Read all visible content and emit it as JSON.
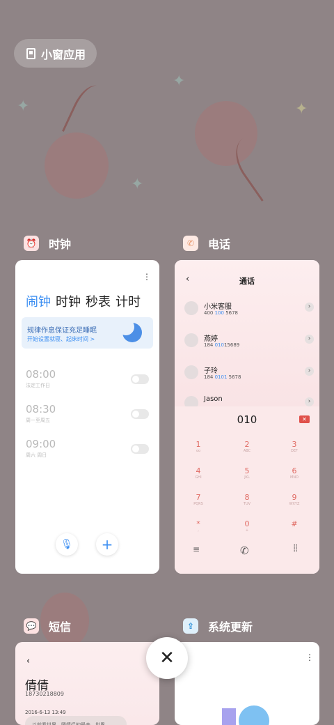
{
  "pill": {
    "label": "小窗应用"
  },
  "cards": {
    "clock": {
      "app_name": "时钟",
      "tabs": [
        "闹钟",
        "时钟",
        "秒表",
        "计时"
      ],
      "banner_title": "规律作息保证充足睡眠",
      "banner_sub": "开始设置就寝、起床时间 >",
      "alarms": [
        {
          "time": "08:00",
          "repeat": "法定工作日"
        },
        {
          "time": "08:30",
          "repeat": "周一至周五"
        },
        {
          "time": "09:00",
          "repeat": "周六 周日"
        }
      ]
    },
    "phone": {
      "app_name": "电话",
      "title": "通话",
      "contacts": [
        {
          "name": "小米客服",
          "num_a": "400 ",
          "num_b": "100",
          "num_c": " 5678"
        },
        {
          "name": "燕婷",
          "num_a": "184 ",
          "num_b": "010",
          "num_c": "15689"
        },
        {
          "name": "子玲",
          "num_a": "184 ",
          "num_b": "0101",
          "num_c": " 5678"
        },
        {
          "name": "Jason",
          "num_a": "",
          "num_b": "",
          "num_c": ""
        }
      ],
      "dialed": "010",
      "keys": [
        {
          "d": "1",
          "l": "oo"
        },
        {
          "d": "2",
          "l": "ABC"
        },
        {
          "d": "3",
          "l": "DEF"
        },
        {
          "d": "4",
          "l": "GHI"
        },
        {
          "d": "5",
          "l": "JKL"
        },
        {
          "d": "6",
          "l": "MNO"
        },
        {
          "d": "7",
          "l": "PQRS"
        },
        {
          "d": "8",
          "l": "TUV"
        },
        {
          "d": "9",
          "l": "WXYZ"
        },
        {
          "d": "*",
          "l": ","
        },
        {
          "d": "0",
          "l": "+"
        },
        {
          "d": "#",
          "l": ""
        }
      ]
    },
    "sms": {
      "app_name": "短信",
      "contact_name": "倩倩",
      "contact_number": "18730218809",
      "date": "2016-6-13 13:49",
      "message_preview": "以前看世界，嗯情侣的最亲，世界"
    },
    "update": {
      "app_name": "系统更新"
    }
  },
  "colors": {
    "accent": "#3d8ff2",
    "dial_digit": "#e06b64",
    "delete_key": "#e0504a"
  }
}
